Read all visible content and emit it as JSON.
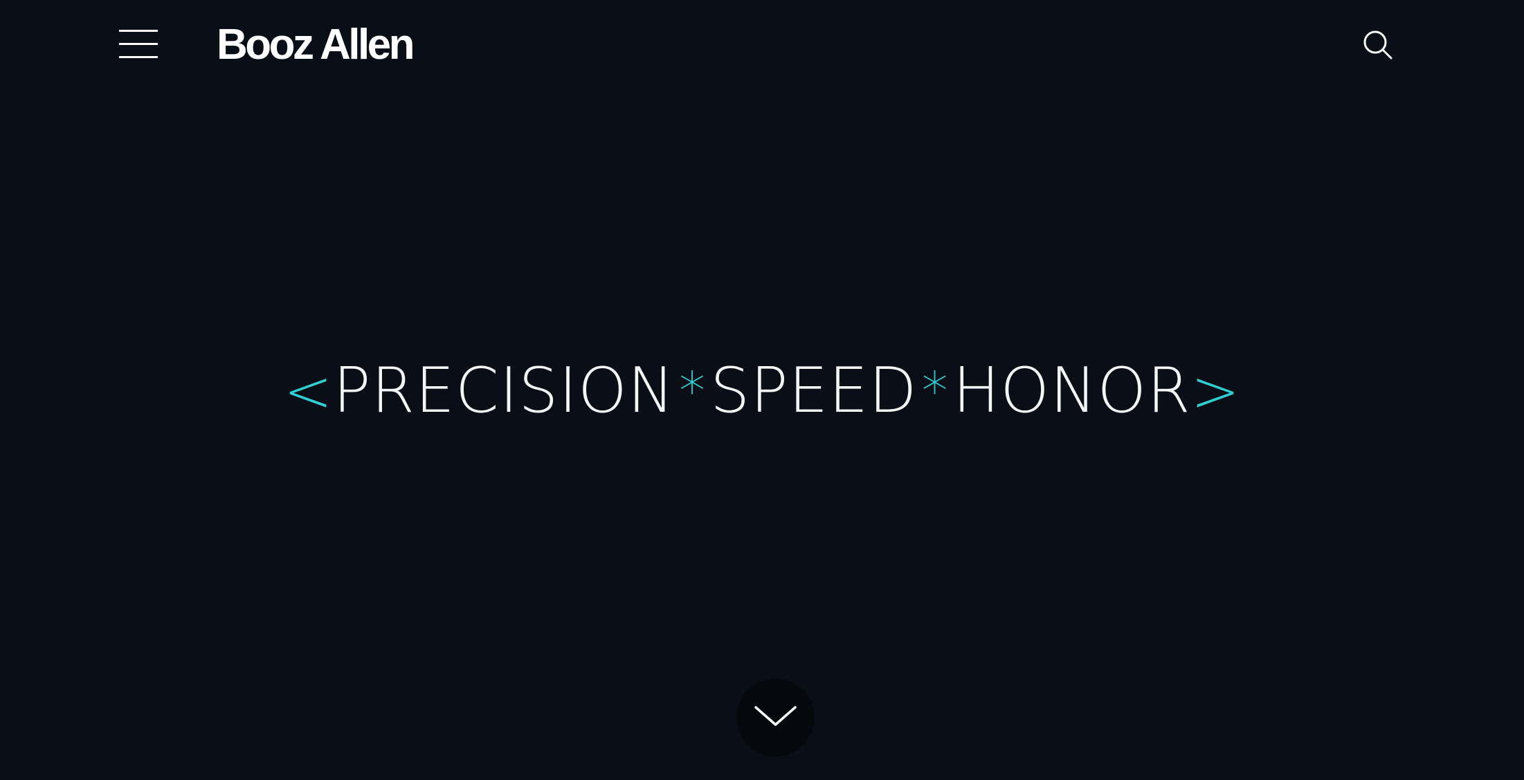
{
  "header": {
    "logo_text": "Booz Allen",
    "menu_icon": "hamburger-icon",
    "search_icon": "search-icon"
  },
  "hero": {
    "tagline": {
      "open_bracket": "<",
      "word_1": "PRECISION",
      "separator_1": "*",
      "word_2": "SPEED",
      "separator_2": "*",
      "word_3": "HONOR",
      "close_bracket": ">"
    },
    "scroll_icon": "chevron-down-icon"
  },
  "colors": {
    "background": "#0a0f17",
    "accent": "#2fd0d3",
    "text": "#ffffff",
    "scroll_button_bg": "#05080d"
  }
}
